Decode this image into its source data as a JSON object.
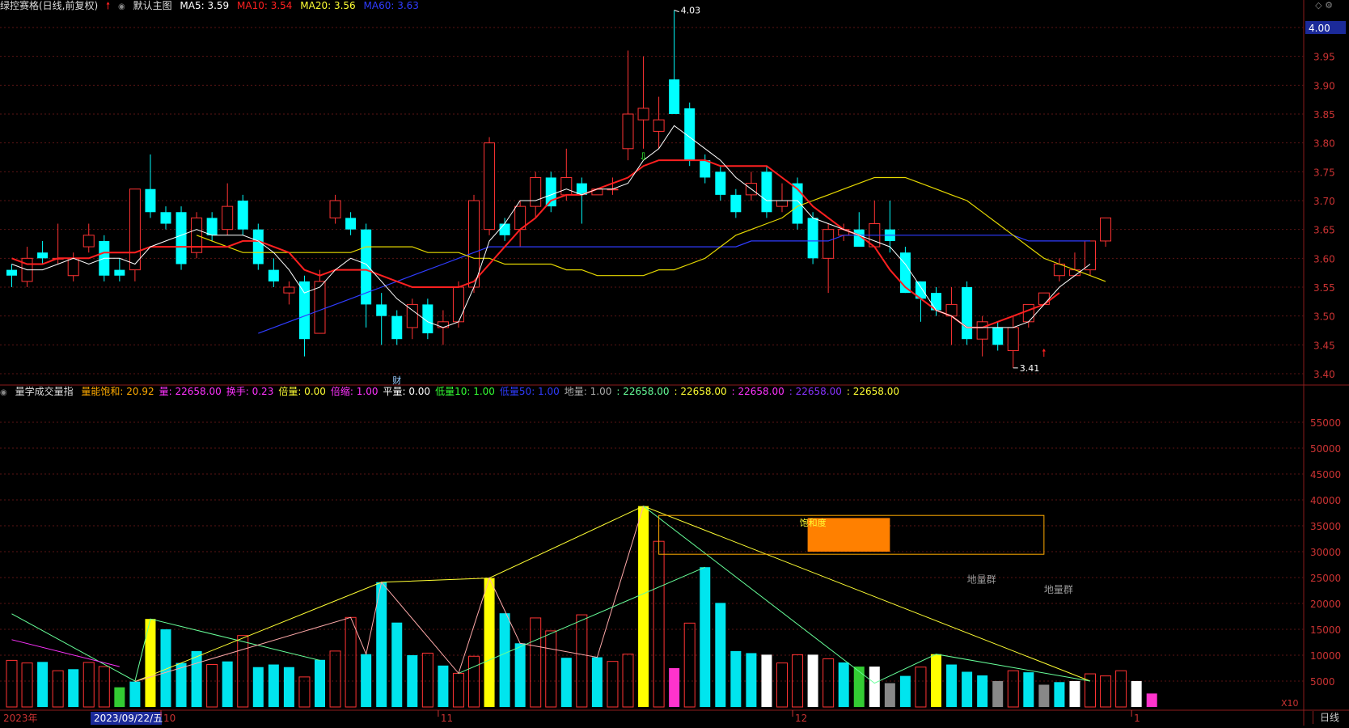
{
  "header": {
    "title": "绿控赛格(日线,前复权)",
    "main_label": "默认主图",
    "ma": [
      {
        "label": "MA5: 3.59",
        "color": "#ffffff"
      },
      {
        "label": "MA10: 3.54",
        "color": "#ff2020"
      },
      {
        "label": "MA20: 3.56",
        "color": "#ffff33"
      },
      {
        "label": "MA60: 3.63",
        "color": "#2f3cff"
      }
    ]
  },
  "price_axis": {
    "ticks": [
      "4.00",
      "3.95",
      "3.90",
      "3.85",
      "3.80",
      "3.75",
      "3.70",
      "3.65",
      "3.60",
      "3.55",
      "3.50",
      "3.45",
      "3.40"
    ],
    "highlight": "4.00"
  },
  "vol_axis": {
    "ticks": [
      "55000",
      "50000",
      "45000",
      "40000",
      "35000",
      "30000",
      "25000",
      "20000",
      "15000",
      "10000",
      "5000"
    ],
    "unit": "X10"
  },
  "indicator_bar": {
    "name": "量学成交量指",
    "items": [
      {
        "label": "量能饱和: 20.92",
        "color": "#ffaa00"
      },
      {
        "label": "量: 22658.00",
        "color": "#ff33ff"
      },
      {
        "label": "换手: 0.23",
        "color": "#ff33ff"
      },
      {
        "label": "倍量: 0.00",
        "color": "#ffff33"
      },
      {
        "label": "倍缩: 1.00",
        "color": "#ff33ff"
      },
      {
        "label": "平量: 0.00",
        "color": "#ffffff"
      },
      {
        "label": "低量10: 1.00",
        "color": "#33ff33"
      },
      {
        "label": "低量50: 1.00",
        "color": "#2f3cff"
      },
      {
        "label": "地量: 1.00",
        "color": "#aaaaaa"
      },
      {
        "label": ": 22658.00",
        "color": "#66ff99"
      },
      {
        "label": ": 22658.00",
        "color": "#ffff33"
      },
      {
        "label": ": 22658.00",
        "color": "#ff33ff"
      },
      {
        "label": ": 22658.00",
        "color": "#8833ff"
      },
      {
        "label": ": 22658.00",
        "color": "#ffff33"
      }
    ]
  },
  "annotations": {
    "high": "4.03",
    "low": "3.41",
    "cai": "财",
    "saturation": "饱和度",
    "dl1": "地量群",
    "dl2": "地量群"
  },
  "date_axis": {
    "year": "2023年",
    "cursor": "2023/09/22/五",
    "months": [
      "10",
      "11",
      "12",
      "1"
    ],
    "period": "日线"
  },
  "chart_data": {
    "type": "candlestick",
    "price_ylim": [
      3.4,
      4.0
    ],
    "volume_ylim": [
      0,
      55000
    ],
    "candles": [
      {
        "o": 3.58,
        "c": 3.57,
        "h": 3.59,
        "l": 3.55
      },
      {
        "o": 3.56,
        "c": 3.6,
        "h": 3.62,
        "l": 3.55
      },
      {
        "o": 3.61,
        "c": 3.6,
        "h": 3.63,
        "l": 3.59
      },
      {
        "o": 3.6,
        "c": 3.6,
        "h": 3.66,
        "l": 3.59
      },
      {
        "o": 3.57,
        "c": 3.6,
        "h": 3.61,
        "l": 3.56
      },
      {
        "o": 3.62,
        "c": 3.64,
        "h": 3.66,
        "l": 3.61
      },
      {
        "o": 3.63,
        "c": 3.57,
        "h": 3.64,
        "l": 3.56
      },
      {
        "o": 3.58,
        "c": 3.57,
        "h": 3.6,
        "l": 3.56
      },
      {
        "o": 3.58,
        "c": 3.72,
        "h": 3.72,
        "l": 3.56
      },
      {
        "o": 3.72,
        "c": 3.68,
        "h": 3.78,
        "l": 3.67
      },
      {
        "o": 3.68,
        "c": 3.66,
        "h": 3.69,
        "l": 3.65
      },
      {
        "o": 3.68,
        "c": 3.59,
        "h": 3.69,
        "l": 3.58
      },
      {
        "o": 3.61,
        "c": 3.67,
        "h": 3.68,
        "l": 3.6
      },
      {
        "o": 3.67,
        "c": 3.64,
        "h": 3.68,
        "l": 3.63
      },
      {
        "o": 3.65,
        "c": 3.69,
        "h": 3.73,
        "l": 3.64
      },
      {
        "o": 3.7,
        "c": 3.65,
        "h": 3.71,
        "l": 3.64
      },
      {
        "o": 3.65,
        "c": 3.59,
        "h": 3.66,
        "l": 3.58
      },
      {
        "o": 3.58,
        "c": 3.56,
        "h": 3.6,
        "l": 3.55
      },
      {
        "o": 3.54,
        "c": 3.55,
        "h": 3.56,
        "l": 3.52
      },
      {
        "o": 3.56,
        "c": 3.46,
        "h": 3.57,
        "l": 3.43
      },
      {
        "o": 3.47,
        "c": 3.56,
        "h": 3.58,
        "l": 3.47
      },
      {
        "o": 3.67,
        "c": 3.7,
        "h": 3.71,
        "l": 3.66
      },
      {
        "o": 3.67,
        "c": 3.65,
        "h": 3.68,
        "l": 3.64
      },
      {
        "o": 3.65,
        "c": 3.52,
        "h": 3.66,
        "l": 3.48
      },
      {
        "o": 3.52,
        "c": 3.5,
        "h": 3.54,
        "l": 3.45
      },
      {
        "o": 3.5,
        "c": 3.46,
        "h": 3.51,
        "l": 3.45
      },
      {
        "o": 3.48,
        "c": 3.52,
        "h": 3.53,
        "l": 3.46
      },
      {
        "o": 3.52,
        "c": 3.47,
        "h": 3.53,
        "l": 3.46
      },
      {
        "o": 3.48,
        "c": 3.49,
        "h": 3.51,
        "l": 3.45
      },
      {
        "o": 3.49,
        "c": 3.55,
        "h": 3.56,
        "l": 3.48
      },
      {
        "o": 3.55,
        "c": 3.7,
        "h": 3.71,
        "l": 3.54
      },
      {
        "o": 3.65,
        "c": 3.8,
        "h": 3.81,
        "l": 3.64
      },
      {
        "o": 3.66,
        "c": 3.64,
        "h": 3.67,
        "l": 3.63
      },
      {
        "o": 3.65,
        "c": 3.69,
        "h": 3.7,
        "l": 3.62
      },
      {
        "o": 3.69,
        "c": 3.74,
        "h": 3.75,
        "l": 3.67
      },
      {
        "o": 3.74,
        "c": 3.69,
        "h": 3.75,
        "l": 3.68
      },
      {
        "o": 3.71,
        "c": 3.74,
        "h": 3.79,
        "l": 3.7
      },
      {
        "o": 3.73,
        "c": 3.71,
        "h": 3.74,
        "l": 3.66
      },
      {
        "o": 3.71,
        "c": 3.72,
        "h": 3.72,
        "l": 3.71
      },
      {
        "o": 3.72,
        "c": 3.72,
        "h": 3.74,
        "l": 3.71
      },
      {
        "o": 3.79,
        "c": 3.85,
        "h": 3.96,
        "l": 3.77
      },
      {
        "o": 3.84,
        "c": 3.86,
        "h": 3.95,
        "l": 3.79
      },
      {
        "o": 3.82,
        "c": 3.84,
        "h": 3.88,
        "l": 3.79
      },
      {
        "o": 3.91,
        "c": 3.85,
        "h": 4.03,
        "l": 3.85
      },
      {
        "o": 3.86,
        "c": 3.77,
        "h": 3.87,
        "l": 3.76
      },
      {
        "o": 3.77,
        "c": 3.74,
        "h": 3.78,
        "l": 3.73
      },
      {
        "o": 3.75,
        "c": 3.71,
        "h": 3.76,
        "l": 3.7
      },
      {
        "o": 3.71,
        "c": 3.68,
        "h": 3.72,
        "l": 3.67
      },
      {
        "o": 3.71,
        "c": 3.73,
        "h": 3.75,
        "l": 3.7
      },
      {
        "o": 3.75,
        "c": 3.68,
        "h": 3.76,
        "l": 3.67
      },
      {
        "o": 3.69,
        "c": 3.7,
        "h": 3.73,
        "l": 3.68
      },
      {
        "o": 3.73,
        "c": 3.66,
        "h": 3.74,
        "l": 3.65
      },
      {
        "o": 3.67,
        "c": 3.6,
        "h": 3.68,
        "l": 3.59
      },
      {
        "o": 3.6,
        "c": 3.65,
        "h": 3.66,
        "l": 3.54
      },
      {
        "o": 3.64,
        "c": 3.65,
        "h": 3.66,
        "l": 3.63
      },
      {
        "o": 3.65,
        "c": 3.62,
        "h": 3.68,
        "l": 3.62
      },
      {
        "o": 3.62,
        "c": 3.66,
        "h": 3.7,
        "l": 3.62
      },
      {
        "o": 3.65,
        "c": 3.63,
        "h": 3.7,
        "l": 3.61
      },
      {
        "o": 3.61,
        "c": 3.54,
        "h": 3.62,
        "l": 3.54
      },
      {
        "o": 3.56,
        "c": 3.53,
        "h": 3.56,
        "l": 3.49
      },
      {
        "o": 3.54,
        "c": 3.51,
        "h": 3.55,
        "l": 3.5
      },
      {
        "o": 3.5,
        "c": 3.52,
        "h": 3.55,
        "l": 3.45
      },
      {
        "o": 3.55,
        "c": 3.46,
        "h": 3.56,
        "l": 3.45
      },
      {
        "o": 3.46,
        "c": 3.49,
        "h": 3.5,
        "l": 3.43
      },
      {
        "o": 3.48,
        "c": 3.45,
        "h": 3.49,
        "l": 3.44
      },
      {
        "o": 3.44,
        "c": 3.48,
        "h": 3.5,
        "l": 3.41
      },
      {
        "o": 3.49,
        "c": 3.52,
        "h": 3.52,
        "l": 3.48
      },
      {
        "o": 3.52,
        "c": 3.54,
        "h": 3.54,
        "l": 3.52
      },
      {
        "o": 3.57,
        "c": 3.59,
        "h": 3.6,
        "l": 3.56
      },
      {
        "o": 3.57,
        "c": 3.58,
        "h": 3.61,
        "l": 3.57
      },
      {
        "o": 3.58,
        "c": 3.63,
        "h": 3.63,
        "l": 3.57
      },
      {
        "o": 3.63,
        "c": 3.67,
        "h": 3.67,
        "l": 3.62
      }
    ],
    "volume": [
      {
        "v": 9000,
        "c": "r"
      },
      {
        "v": 8500,
        "c": "r"
      },
      {
        "v": 8700,
        "c": "c"
      },
      {
        "v": 7000,
        "c": "r"
      },
      {
        "v": 7300,
        "c": "c"
      },
      {
        "v": 8600,
        "c": "r"
      },
      {
        "v": 7800,
        "c": "r"
      },
      {
        "v": 3800,
        "c": "g"
      },
      {
        "v": 4900,
        "c": "c"
      },
      {
        "v": 17000,
        "c": "y"
      },
      {
        "v": 15000,
        "c": "c"
      },
      {
        "v": 8500,
        "c": "c"
      },
      {
        "v": 10800,
        "c": "c"
      },
      {
        "v": 8200,
        "c": "r"
      },
      {
        "v": 8800,
        "c": "c"
      },
      {
        "v": 13800,
        "c": "r"
      },
      {
        "v": 7700,
        "c": "c"
      },
      {
        "v": 8200,
        "c": "c"
      },
      {
        "v": 7700,
        "c": "c"
      },
      {
        "v": 5800,
        "c": "r"
      },
      {
        "v": 9100,
        "c": "c"
      },
      {
        "v": 10800,
        "c": "r"
      },
      {
        "v": 17300,
        "c": "r"
      },
      {
        "v": 10200,
        "c": "c"
      },
      {
        "v": 24100,
        "c": "c"
      },
      {
        "v": 16300,
        "c": "c"
      },
      {
        "v": 10000,
        "c": "c"
      },
      {
        "v": 10400,
        "c": "r"
      },
      {
        "v": 8000,
        "c": "c"
      },
      {
        "v": 6500,
        "c": "r"
      },
      {
        "v": 9800,
        "c": "r"
      },
      {
        "v": 24900,
        "c": "y"
      },
      {
        "v": 18100,
        "c": "c"
      },
      {
        "v": 12300,
        "c": "c"
      },
      {
        "v": 17200,
        "c": "r"
      },
      {
        "v": 14700,
        "c": "r"
      },
      {
        "v": 9500,
        "c": "c"
      },
      {
        "v": 17800,
        "c": "r"
      },
      {
        "v": 9600,
        "c": "c"
      },
      {
        "v": 8800,
        "c": "r"
      },
      {
        "v": 10200,
        "c": "r"
      },
      {
        "v": 38800,
        "c": "y"
      },
      {
        "v": 32000,
        "c": "r"
      },
      {
        "v": 7500,
        "c": "m"
      },
      {
        "v": 16200,
        "c": "r"
      },
      {
        "v": 27000,
        "c": "c"
      },
      {
        "v": 20100,
        "c": "c"
      },
      {
        "v": 10800,
        "c": "c"
      },
      {
        "v": 10400,
        "c": "c"
      },
      {
        "v": 10100,
        "c": "w"
      },
      {
        "v": 8500,
        "c": "r"
      },
      {
        "v": 10100,
        "c": "r"
      },
      {
        "v": 10100,
        "c": "w"
      },
      {
        "v": 9300,
        "c": "r"
      },
      {
        "v": 8600,
        "c": "c"
      },
      {
        "v": 7800,
        "c": "g"
      },
      {
        "v": 7800,
        "c": "w"
      },
      {
        "v": 4600,
        "c": "s"
      },
      {
        "v": 6000,
        "c": "c"
      },
      {
        "v": 7700,
        "c": "r"
      },
      {
        "v": 10200,
        "c": "y"
      },
      {
        "v": 8200,
        "c": "c"
      },
      {
        "v": 6800,
        "c": "c"
      },
      {
        "v": 6100,
        "c": "c"
      },
      {
        "v": 5000,
        "c": "s"
      },
      {
        "v": 7000,
        "c": "r"
      },
      {
        "v": 6700,
        "c": "c"
      },
      {
        "v": 4300,
        "c": "s"
      },
      {
        "v": 4800,
        "c": "c"
      },
      {
        "v": 5000,
        "c": "w"
      },
      {
        "v": 6400,
        "c": "r"
      },
      {
        "v": 6000,
        "c": "r"
      },
      {
        "v": 7000,
        "c": "r"
      },
      {
        "v": 5000,
        "c": "w"
      },
      {
        "v": 2600,
        "c": "m"
      }
    ],
    "ma5": [
      3.59,
      3.58,
      3.58,
      3.59,
      3.6,
      3.59,
      3.6,
      3.6,
      3.59,
      3.62,
      3.63,
      3.64,
      3.65,
      3.64,
      3.64,
      3.64,
      3.63,
      3.61,
      3.58,
      3.54,
      3.55,
      3.58,
      3.6,
      3.59,
      3.56,
      3.53,
      3.51,
      3.49,
      3.48,
      3.49,
      3.55,
      3.63,
      3.66,
      3.7,
      3.7,
      3.71,
      3.72,
      3.71,
      3.72,
      3.72,
      3.73,
      3.77,
      3.79,
      3.83,
      3.81,
      3.79,
      3.77,
      3.74,
      3.72,
      3.7,
      3.7,
      3.7,
      3.67,
      3.66,
      3.65,
      3.64,
      3.63,
      3.62,
      3.59,
      3.55,
      3.51,
      3.5,
      3.48,
      3.48,
      3.48,
      3.48,
      3.49,
      3.52,
      3.55,
      3.57,
      3.59
    ],
    "ma10": [
      3.6,
      3.59,
      3.59,
      3.6,
      3.6,
      3.6,
      3.61,
      3.61,
      3.61,
      3.62,
      3.62,
      3.62,
      3.62,
      3.62,
      3.62,
      3.63,
      3.63,
      3.62,
      3.61,
      3.58,
      3.57,
      3.58,
      3.58,
      3.58,
      3.57,
      3.56,
      3.55,
      3.55,
      3.55,
      3.55,
      3.56,
      3.59,
      3.62,
      3.65,
      3.67,
      3.7,
      3.71,
      3.71,
      3.72,
      3.73,
      3.74,
      3.76,
      3.77,
      3.77,
      3.77,
      3.77,
      3.76,
      3.76,
      3.76,
      3.76,
      3.74,
      3.72,
      3.69,
      3.67,
      3.65,
      3.64,
      3.62,
      3.58,
      3.55,
      3.53,
      3.51,
      3.5,
      3.48,
      3.48,
      3.49,
      3.5,
      3.51,
      3.52,
      3.54
    ],
    "ma20": [
      3.64,
      3.63,
      3.62,
      3.61,
      3.61,
      3.61,
      3.61,
      3.61,
      3.61,
      3.61,
      3.61,
      3.62,
      3.62,
      3.62,
      3.62,
      3.61,
      3.61,
      3.61,
      3.6,
      3.6,
      3.59,
      3.59,
      3.59,
      3.59,
      3.58,
      3.58,
      3.57,
      3.57,
      3.57,
      3.57,
      3.58,
      3.58,
      3.59,
      3.6,
      3.62,
      3.64,
      3.65,
      3.66,
      3.67,
      3.69,
      3.7,
      3.71,
      3.72,
      3.73,
      3.74,
      3.74,
      3.74,
      3.73,
      3.72,
      3.71,
      3.7,
      3.68,
      3.66,
      3.64,
      3.62,
      3.6,
      3.59,
      3.58,
      3.57,
      3.56
    ],
    "ma60": [
      3.47,
      3.48,
      3.49,
      3.5,
      3.51,
      3.52,
      3.53,
      3.54,
      3.55,
      3.56,
      3.57,
      3.58,
      3.59,
      3.6,
      3.61,
      3.62,
      3.62,
      3.62,
      3.62,
      3.62,
      3.62,
      3.62,
      3.62,
      3.62,
      3.62,
      3.62,
      3.62,
      3.62,
      3.62,
      3.62,
      3.62,
      3.62,
      3.63,
      3.63,
      3.63,
      3.63,
      3.63,
      3.63,
      3.64,
      3.64,
      3.64,
      3.64,
      3.64,
      3.64,
      3.64,
      3.64,
      3.64,
      3.64,
      3.64,
      3.64,
      3.63,
      3.63,
      3.63,
      3.63,
      3.63
    ]
  }
}
